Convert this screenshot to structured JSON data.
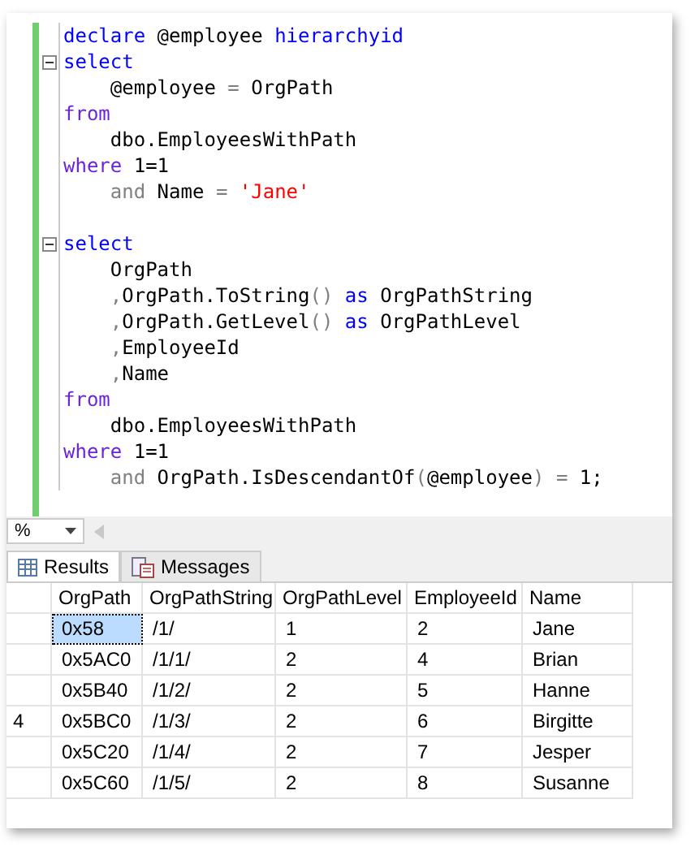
{
  "editor": {
    "lines": [
      {
        "fold": false,
        "tokens": [
          {
            "kind": "keyword",
            "text": "declare"
          },
          {
            "kind": "plain",
            "text": " @employee "
          },
          {
            "kind": "keyword",
            "text": "hierarchyid"
          }
        ]
      },
      {
        "fold": true,
        "tokens": [
          {
            "kind": "keyword",
            "text": "select"
          }
        ]
      },
      {
        "fold": false,
        "tokens": [
          {
            "kind": "plain",
            "text": "    @employee "
          },
          {
            "kind": "operator",
            "text": "="
          },
          {
            "kind": "plain",
            "text": " OrgPath"
          }
        ]
      },
      {
        "fold": false,
        "tokens": [
          {
            "kind": "clause",
            "text": "from"
          }
        ]
      },
      {
        "fold": false,
        "tokens": [
          {
            "kind": "plain",
            "text": "    dbo.EmployeesWithPath"
          }
        ]
      },
      {
        "fold": false,
        "tokens": [
          {
            "kind": "clause",
            "text": "where"
          },
          {
            "kind": "plain",
            "text": " 1=1"
          }
        ]
      },
      {
        "fold": false,
        "tokens": [
          {
            "kind": "operator",
            "text": "    and"
          },
          {
            "kind": "plain",
            "text": " Name "
          },
          {
            "kind": "operator",
            "text": "= "
          },
          {
            "kind": "string",
            "text": "'Jane'"
          }
        ]
      },
      {
        "fold": false
      },
      {
        "fold": true,
        "tokens": [
          {
            "kind": "keyword",
            "text": "select"
          }
        ]
      },
      {
        "fold": false,
        "tokens": [
          {
            "kind": "plain",
            "text": "    OrgPath"
          }
        ]
      },
      {
        "fold": false,
        "tokens": [
          {
            "kind": "operator",
            "text": "    ,"
          },
          {
            "kind": "plain",
            "text": "OrgPath.ToString"
          },
          {
            "kind": "operator",
            "text": "() "
          },
          {
            "kind": "keyword",
            "text": "as"
          },
          {
            "kind": "plain",
            "text": " OrgPathString"
          }
        ]
      },
      {
        "fold": false,
        "tokens": [
          {
            "kind": "operator",
            "text": "    ,"
          },
          {
            "kind": "plain",
            "text": "OrgPath.GetLevel"
          },
          {
            "kind": "operator",
            "text": "() "
          },
          {
            "kind": "keyword",
            "text": "as"
          },
          {
            "kind": "plain",
            "text": " OrgPathLevel"
          }
        ]
      },
      {
        "fold": false,
        "tokens": [
          {
            "kind": "operator",
            "text": "    ,"
          },
          {
            "kind": "plain",
            "text": "EmployeeId"
          }
        ]
      },
      {
        "fold": false,
        "tokens": [
          {
            "kind": "operator",
            "text": "    ,"
          },
          {
            "kind": "plain",
            "text": "Name"
          }
        ]
      },
      {
        "fold": false,
        "tokens": [
          {
            "kind": "clause",
            "text": "from"
          }
        ]
      },
      {
        "fold": false,
        "tokens": [
          {
            "kind": "plain",
            "text": "    dbo.EmployeesWithPath"
          }
        ]
      },
      {
        "fold": false,
        "tokens": [
          {
            "kind": "clause",
            "text": "where"
          },
          {
            "kind": "plain",
            "text": " 1=1"
          }
        ]
      },
      {
        "fold": false,
        "tokens": [
          {
            "kind": "operator",
            "text": "    and"
          },
          {
            "kind": "plain",
            "text": " OrgPath.IsDescendantOf"
          },
          {
            "kind": "operator",
            "text": "("
          },
          {
            "kind": "plain",
            "text": "@employee"
          },
          {
            "kind": "operator",
            "text": ") ="
          },
          {
            "kind": "plain",
            "text": " 1;"
          }
        ]
      }
    ]
  },
  "zoom": {
    "value": "%"
  },
  "tabs": [
    {
      "label": "Results",
      "selected": true
    },
    {
      "label": "Messages",
      "selected": false
    }
  ],
  "grid": {
    "columns": [
      "OrgPath",
      "OrgPathString",
      "OrgPathLevel",
      "EmployeeId",
      "Name"
    ],
    "rows": [
      {
        "selected": true,
        "cells": [
          "0x58",
          "/1/",
          "1",
          "2",
          "Jane"
        ]
      },
      {
        "selected": false,
        "cells": [
          "0x5AC0",
          "/1/1/",
          "2",
          "4",
          "Brian"
        ]
      },
      {
        "selected": false,
        "cells": [
          "0x5B40",
          "/1/2/",
          "2",
          "5",
          "Hanne"
        ]
      },
      {
        "row_number": "4",
        "selected": false,
        "cells": [
          "0x5BC0",
          "/1/3/",
          "2",
          "6",
          "Birgitte"
        ]
      },
      {
        "selected": false,
        "cells": [
          "0x5C20",
          "/1/4/",
          "2",
          "7",
          "Jesper"
        ]
      },
      {
        "selected": false,
        "cells": [
          "0x5C60",
          "/1/5/",
          "2",
          "8",
          "Susanne"
        ]
      }
    ]
  }
}
